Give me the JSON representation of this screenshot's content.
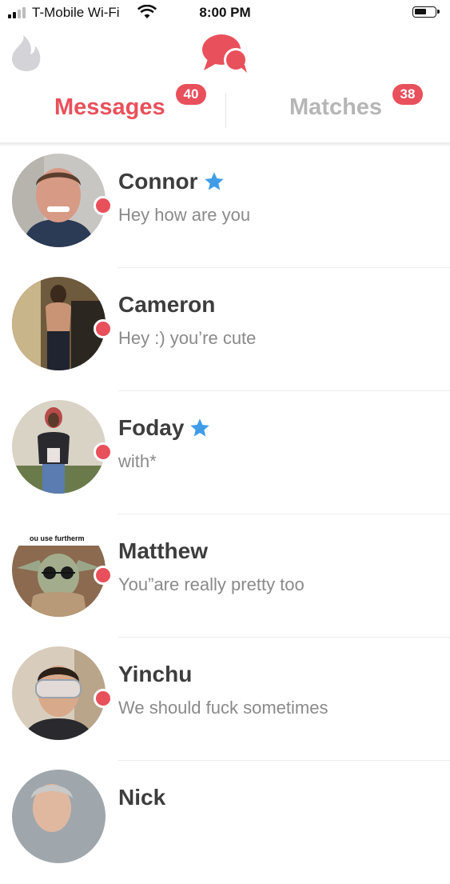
{
  "status_bar": {
    "carrier": "T-Mobile Wi-Fi",
    "time": "8:00 PM",
    "icons": [
      "signal-bars-icon",
      "wifi-icon",
      "battery-icon"
    ]
  },
  "top_nav": {
    "icons": [
      "flame-icon",
      "chat-bubbles-icon"
    ]
  },
  "tabs": {
    "messages": {
      "label": "Messages",
      "badge": "40"
    },
    "matches": {
      "label": "Matches",
      "badge": "38"
    }
  },
  "colors": {
    "accent": "#e8505b",
    "star": "#3f9de8",
    "inactive_tab": "#b6b6b6",
    "preview_text": "#8a8a8a"
  },
  "conversations": [
    {
      "name": "Connor",
      "preview": "Hey how are you",
      "starred": true,
      "unread": true
    },
    {
      "name": "Cameron",
      "preview": "Hey :) you’re cute",
      "starred": false,
      "unread": true
    },
    {
      "name": "Foday",
      "preview": "with*",
      "starred": true,
      "unread": true
    },
    {
      "name": "Matthew",
      "preview": "You”are really pretty too",
      "starred": false,
      "unread": true,
      "avatar_caption": "ou use furtherm"
    },
    {
      "name": "Yinchu",
      "preview": "We should fuck sometimes",
      "starred": false,
      "unread": true
    },
    {
      "name": "Nick",
      "preview": "",
      "starred": false,
      "unread": false
    }
  ]
}
